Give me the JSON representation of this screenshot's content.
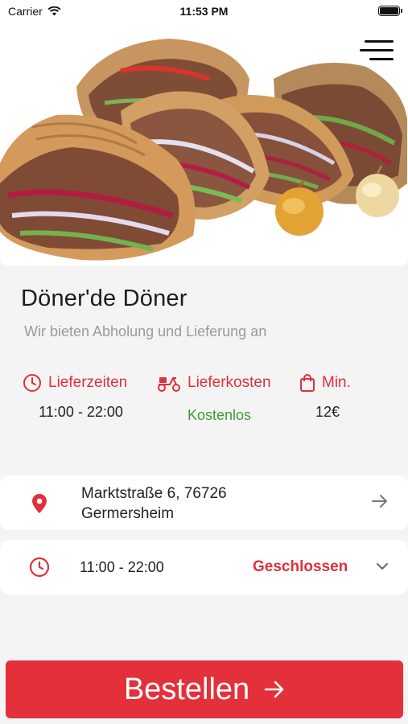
{
  "status_bar": {
    "carrier": "Carrier",
    "time": "11:53 PM"
  },
  "restaurant": {
    "name": "Döner'de Döner",
    "tagline": "Wir bieten Abholung und Lieferung an"
  },
  "info": {
    "delivery_times": {
      "label": "Lieferzeiten",
      "value": "11:00 - 22:00",
      "icon": "clock-icon"
    },
    "delivery_cost": {
      "label": "Lieferkosten",
      "value": "Kostenlos",
      "icon": "scooter-icon"
    },
    "minimum": {
      "label": "Min.",
      "value": "12€",
      "icon": "shopping-bag-icon"
    }
  },
  "address": {
    "line1": "Marktstraße 6, 76726",
    "line2": "Germersheim",
    "icon": "location-pin-icon"
  },
  "hours": {
    "range": "11:00 - 22:00",
    "status": "Geschlossen",
    "icon": "clock-icon"
  },
  "order_button": {
    "label": "Bestellen"
  },
  "colors": {
    "accent": "#e0303a",
    "free": "#3f9a35",
    "background": "#f4f4f5"
  }
}
